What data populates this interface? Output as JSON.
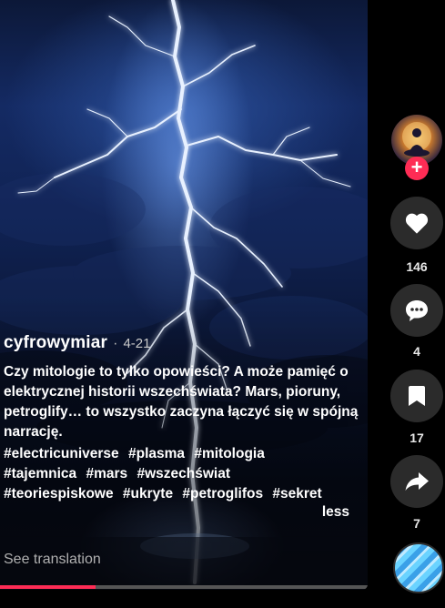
{
  "post": {
    "author": "cyfrowymiar",
    "separator": "·",
    "date": "4-21",
    "description": "Czy mitologie to tylko opowieści? A może pamięć o elektrycznej historii wszechświata? Mars, pioruny, petroglify… to wszystko zaczyna łączyć się w spójną narrację.",
    "hashtags": [
      "#electricuniverse",
      "#plasma",
      "#mitologia",
      "#tajemnica",
      "#mars",
      "#wszechświat",
      "#teoriespiskowe",
      "#ukryte",
      "#petroglifos",
      "#sekret"
    ],
    "less_label": "less",
    "see_translation": "See translation",
    "progress": 0.26
  },
  "actions": {
    "follow_symbol": "+",
    "likes": "146",
    "comments": "4",
    "saves": "17",
    "shares": "7"
  },
  "icons": {
    "like": "heart-icon",
    "comment": "comment-bubble-icon",
    "save": "bookmark-icon",
    "share": "share-arrow-icon",
    "music": "music-disc-icon"
  },
  "colors": {
    "accent": "#fe2c55",
    "button_bg": "#2b2b2b"
  }
}
